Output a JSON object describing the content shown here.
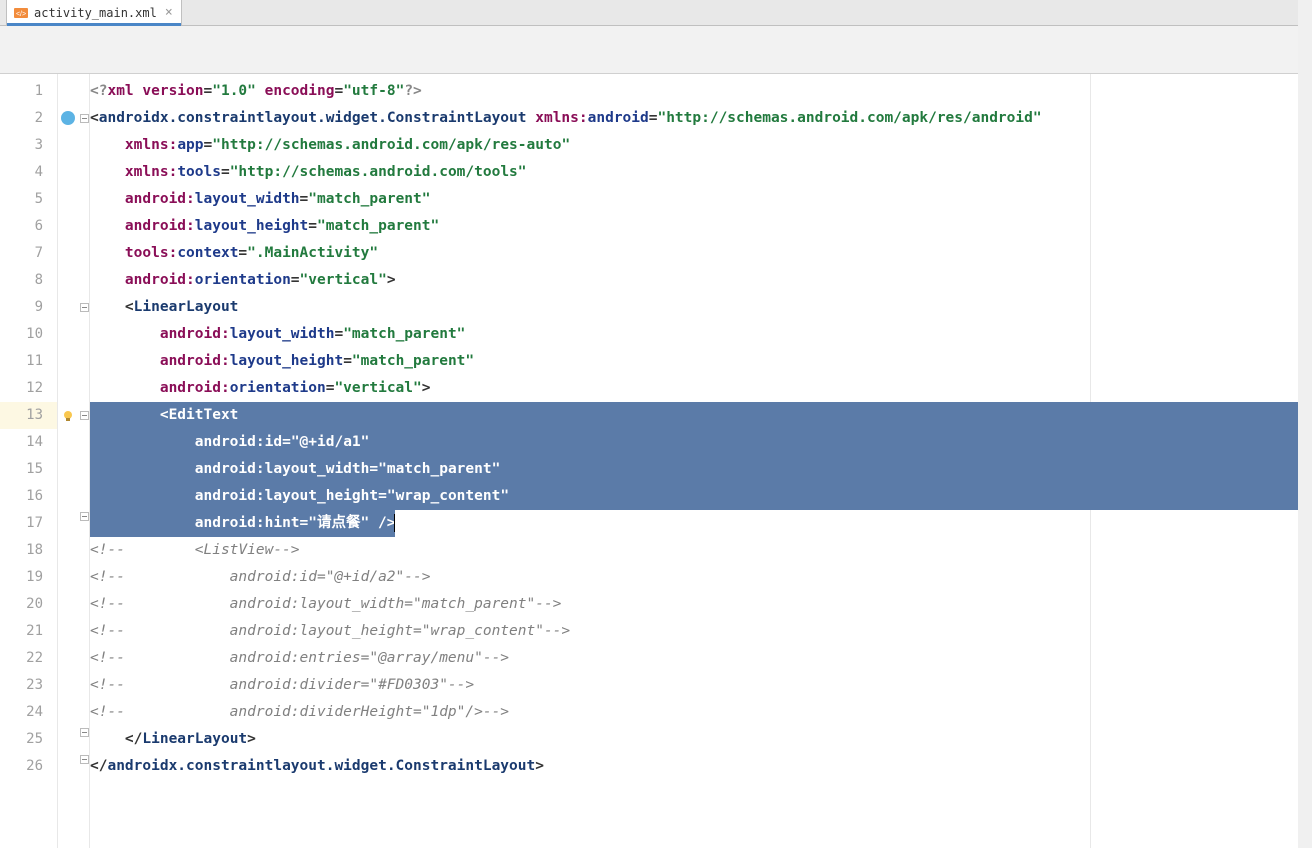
{
  "tab": {
    "label": "activity_main.xml"
  },
  "gutter_lines": [
    "1",
    "2",
    "3",
    "4",
    "5",
    "6",
    "7",
    "8",
    "9",
    "10",
    "11",
    "12",
    "13",
    "14",
    "15",
    "16",
    "17",
    "18",
    "19",
    "20",
    "21",
    "22",
    "23",
    "24",
    "25",
    "26"
  ],
  "selection": {
    "start": 13,
    "end": 17
  },
  "code": {
    "l1": {
      "p1": "<?",
      "p2": "xml version",
      "p3": "=",
      "p4": "\"1.0\"",
      "p5": " encoding",
      "p6": "=",
      "p7": "\"utf-8\"",
      "p8": "?>"
    },
    "l2": {
      "p1": "<",
      "p2": "androidx.constraintlayout.widget.ConstraintLayout ",
      "p3": "xmlns:",
      "p4": "android",
      "p5": "=",
      "p6": "\"http://schemas.android.com/apk/res/android\""
    },
    "l3": {
      "p1": "    ",
      "p2": "xmlns:",
      "p3": "app",
      "p4": "=",
      "p5": "\"http://schemas.android.com/apk/res-auto\""
    },
    "l4": {
      "p1": "    ",
      "p2": "xmlns:",
      "p3": "tools",
      "p4": "=",
      "p5": "\"http://schemas.android.com/tools\""
    },
    "l5": {
      "p1": "    ",
      "p2": "android:",
      "p3": "layout_width",
      "p4": "=",
      "p5": "\"match_parent\""
    },
    "l6": {
      "p1": "    ",
      "p2": "android:",
      "p3": "layout_height",
      "p4": "=",
      "p5": "\"match_parent\""
    },
    "l7": {
      "p1": "    ",
      "p2": "tools:",
      "p3": "context",
      "p4": "=",
      "p5": "\".MainActivity\""
    },
    "l8": {
      "p1": "    ",
      "p2": "android:",
      "p3": "orientation",
      "p4": "=",
      "p5": "\"vertical\"",
      "p6": ">"
    },
    "l9": {
      "p1": "    <",
      "p2": "LinearLayout"
    },
    "l10": {
      "p1": "        ",
      "p2": "android:",
      "p3": "layout_width",
      "p4": "=",
      "p5": "\"match_parent\""
    },
    "l11": {
      "p1": "        ",
      "p2": "android:",
      "p3": "layout_height",
      "p4": "=",
      "p5": "\"match_parent\""
    },
    "l12": {
      "p1": "        ",
      "p2": "android:",
      "p3": "orientation",
      "p4": "=",
      "p5": "\"vertical\"",
      "p6": ">"
    },
    "l13": {
      "p1": "        <",
      "p2": "EditText"
    },
    "l14": {
      "p1": "            ",
      "p2": "android:",
      "p3": "id",
      "p4": "=",
      "p5": "\"@+id/a1\""
    },
    "l15": {
      "p1": "            ",
      "p2": "android:",
      "p3": "layout_width",
      "p4": "=",
      "p5": "\"match_parent\""
    },
    "l16": {
      "p1": "            ",
      "p2": "android:",
      "p3": "layout_height",
      "p4": "=",
      "p5": "\"wrap_content\""
    },
    "l17": {
      "p1": "            ",
      "p2": "android:",
      "p3": "hint",
      "p4": "=",
      "p5": "\"请点餐\"",
      "p6": " />"
    },
    "l18": {
      "p1": "<!--        <ListView-->"
    },
    "l19": {
      "p1": "<!--            android:id=\"@+id/a2\"-->"
    },
    "l20": {
      "p1": "<!--            android:layout_width=\"match_parent\"-->"
    },
    "l21": {
      "p1": "<!--            android:layout_height=\"wrap_content\"-->"
    },
    "l22": {
      "p1": "<!--            android:entries=\"@array/menu\"-->"
    },
    "l23": {
      "p1": "<!--            android:divider=\"#FD0303\"-->"
    },
    "l24": {
      "p1": "<!--            android:dividerHeight=\"1dp\"/>-->"
    },
    "l25": {
      "p1": "    </",
      "p2": "LinearLayout",
      "p3": ">"
    },
    "l26": {
      "p1": "</",
      "p2": "androidx.constraintlayout.widget.ConstraintLayout",
      "p3": ">"
    }
  }
}
